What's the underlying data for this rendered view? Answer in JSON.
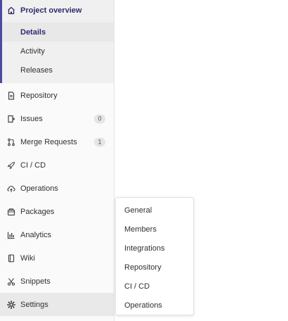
{
  "sidebar": {
    "project_overview": {
      "label": "Project overview",
      "icon": "home-icon",
      "subitems": [
        {
          "label": "Details",
          "active": true
        },
        {
          "label": "Activity"
        },
        {
          "label": "Releases"
        }
      ]
    },
    "items": [
      {
        "label": "Repository",
        "icon": "document-icon"
      },
      {
        "label": "Issues",
        "icon": "issues-icon",
        "badge": "0"
      },
      {
        "label": "Merge Requests",
        "icon": "merge-request-icon",
        "badge": "1"
      },
      {
        "label": "CI / CD",
        "icon": "rocket-icon"
      },
      {
        "label": "Operations",
        "icon": "cloud-icon"
      },
      {
        "label": "Packages",
        "icon": "package-icon"
      },
      {
        "label": "Analytics",
        "icon": "chart-icon"
      },
      {
        "label": "Wiki",
        "icon": "book-icon"
      },
      {
        "label": "Snippets",
        "icon": "scissors-icon"
      },
      {
        "label": "Settings",
        "icon": "gear-icon"
      }
    ]
  },
  "settings_flyout": {
    "items": [
      "General",
      "Members",
      "Integrations",
      "Repository",
      "CI / CD",
      "Operations"
    ]
  },
  "colors": {
    "accent": "#4b4ba3",
    "active_text": "#2c2c6e",
    "sidebar_bg": "#fafafa",
    "active_bg": "#f0f0f0"
  }
}
